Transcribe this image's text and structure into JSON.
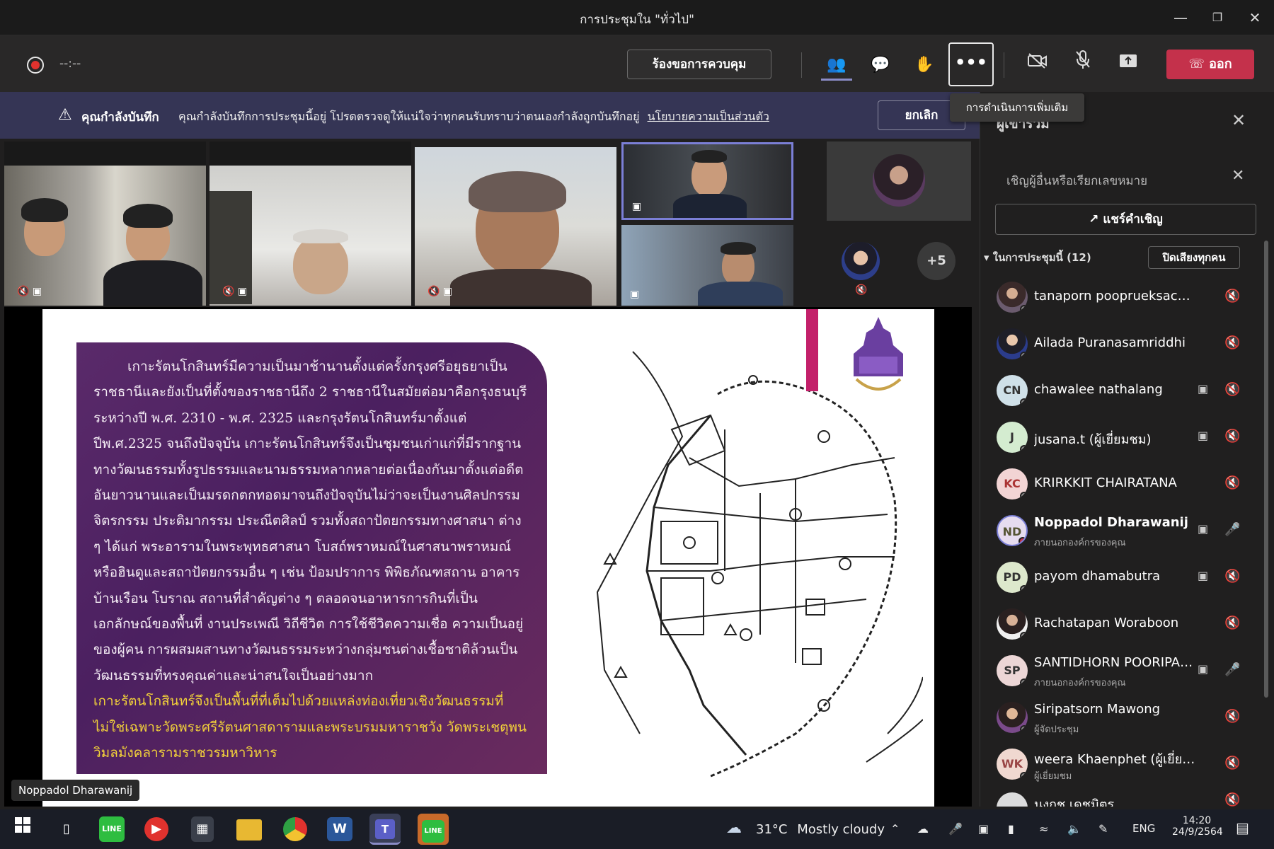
{
  "window": {
    "title": "การประชุมใน \"ทั่วไป\""
  },
  "toolbar": {
    "record_time": "--:--",
    "request_control": "ร้องขอการควบคุม",
    "more_label": "•••",
    "more_tooltip": "การดำเนินการเพิ่มเติม",
    "leave_label": "ออก"
  },
  "banner": {
    "title": "คุณกำลังบันทึก",
    "message": "คุณกำลังบันทึกการประชุมนี้อยู่ โปรดตรวจดูให้แน่ใจว่าทุกคนรับทราบว่าตนเองกำลังถูกบันทึกอยู่",
    "policy_link": "นโยบายความเป็นส่วนตัว",
    "cancel": "ยกเลิก"
  },
  "video": {
    "overflow_count": "+5"
  },
  "stage": {
    "speaker_label": "Noppadol Dharawanij",
    "slide_paragraph": "เกาะรัตนโกสินทร์มีความเป็นมาช้านานตั้งแต่ครั้งกรุงศรีอยุธยาเป็นราชธานีและยังเป็นที่ตั้งของราชธานีถึง 2 ราชธานีในสมัยต่อมาคือกรุงธนบุรี ระหว่างปี พ.ศ. 2310 - พ.ศ. 2325 และกรุงรัตนโกสินทร์มาตั้งแต่ปีพ.ศ.2325 จนถึงปัจจุบัน เกาะรัตนโกสินทร์จึงเป็นชุมชนเก่าแก่ที่มีรากฐานทางวัฒนธรรมทั้งรูปธรรมและนามธรรมหลากหลายต่อเนื่องกันมาตั้งแต่อดีตอันยาวนานและเป็นมรดกตกทอดมาจนถึงปัจจุบันไม่ว่าจะเป็นงานศิลปกรรม จิตรกรรม ประติมากรรม ประณีตศิลป์ รวมทั้งสถาปัตยกรรมทางศาสนา ต่าง ๆ ได้แก่ พระอารามในพระพุทธศาสนา โบสถ์พราหมณ์ในศาสนาพราหมณ์หรือฮินดูและสถาปัตยกรรมอื่น ๆ เช่น ป้อมปราการ พิพิธภัณฑสถาน อาคารบ้านเรือน โบราณ สถานที่สำคัญต่าง ๆ ตลอดจนอาหารการกินที่เป็นเอกลักษณ์ของพื้นที่ งานประเพณี วิถีชีวิต การใช้ชีวิตความเชื่อ ความเป็นอยู่ของผู้คน การผสมผสานทางวัฒนธรรมระหว่างกลุ่มชนต่างเชื้อชาติล้วนเป็นวัฒนธรรมที่ทรงคุณค่าและน่าสนใจเป็นอย่างมาก",
    "slide_highlight": "เกาะรัตนโกสินทร์จึงเป็นพื้นที่ที่เต็มไปด้วยแหล่งท่องเที่ยวเชิงวัฒนธรรมที่ไม่ใช่เฉพาะวัดพระศรีรัตนศาสดารามและพระบรมมหาราชวัง วัดพระเชตุพนวิมลมังคลารามราชวรมหาวิหาร"
  },
  "panel": {
    "title": "ผู้เข้าร่วม",
    "invite_placeholder": "เชิญผู้อื่นหรือเรียกเลขหมาย",
    "share_invite": "แชร์คำเชิญ",
    "section": "ในการประชุมนี้ (12)",
    "mute_all": "ปิดเสียงทุกคน",
    "participants": [
      {
        "initials": "",
        "name": "tanaporn pooprueksachat",
        "sub": ""
      },
      {
        "initials": "",
        "name": "Ailada Puranasamriddhi",
        "sub": ""
      },
      {
        "initials": "CN",
        "name": "chawalee nathalang",
        "sub": ""
      },
      {
        "initials": "J",
        "name": "jusana.t (ผู้เยี่ยมชม)",
        "sub": ""
      },
      {
        "initials": "KC",
        "name": "KRIRKKIT CHAIRATANA",
        "sub": ""
      },
      {
        "initials": "ND",
        "name": "Noppadol Dharawanij",
        "sub": "ภายนอกองค์กรของคุณ"
      },
      {
        "initials": "PD",
        "name": "payom dhamabutra",
        "sub": ""
      },
      {
        "initials": "",
        "name": "Rachatapan Woraboon",
        "sub": ""
      },
      {
        "initials": "SP",
        "name": "SANTIDHORN POORIPAK...",
        "sub": "ภายนอกองค์กรของคุณ"
      },
      {
        "initials": "",
        "name": "Siripatsorn Mawong",
        "sub": "ผู้จัดประชุม"
      },
      {
        "initials": "WK",
        "name": "weera Khaenphet (ผู้เยี่ยมชม)",
        "sub": "ผู้เยี่ยมชม"
      },
      {
        "initials": "",
        "name": "นงกช เดชมิตร",
        "sub": ""
      }
    ]
  },
  "taskbar": {
    "temperature": "31°C",
    "weather": "Mostly cloudy",
    "language": "ENG",
    "time": "14:20",
    "date": "24/9/2564"
  },
  "colors": {
    "leave": "#c4314b",
    "banner": "#353555",
    "slide_purple": "#5a2a6a",
    "highlight": "#f2d13a"
  }
}
